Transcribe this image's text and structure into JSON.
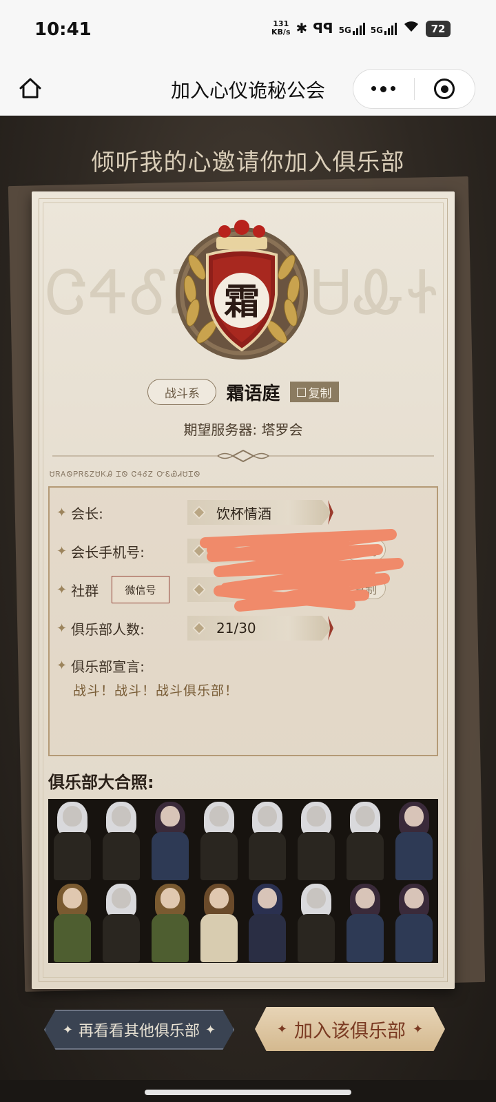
{
  "status_bar": {
    "time": "10:41",
    "speed_value": "131",
    "speed_unit": "KB/s",
    "network_1": "5G",
    "network_2": "5G",
    "battery": "72"
  },
  "nav": {
    "title": "加入心仪诡秘公会"
  },
  "page": {
    "headline": "倾听我的心邀请你加入俱乐部",
    "watermark_left": "ᏣᏎᎴᏃ",
    "watermark_right": "ᎴᏌᎲᏐ",
    "rune_line": "ᏌᏒᎪᏫᏢᏒᏋᏃᏌᏦᎯ ᏆᏫ ᏣᏎᎴᏃ ᏅᏋᏯᏗᏌᏆᏫ"
  },
  "club": {
    "emblem_char": "霜",
    "type_tag": "战斗系",
    "name": "霜语庭",
    "copy_label": "复制",
    "server_label": "期望服务器:",
    "server_value": "塔罗会"
  },
  "info": {
    "leader_label": "会长:",
    "leader_value": "饮杯情酒",
    "phone_label": "会长手机号:",
    "phone_copy": "复制",
    "community_label": "社群",
    "community_tag": "微信号",
    "community_copy": "复制",
    "members_label": "俱乐部人数:",
    "members_value": "21/30",
    "manifesto_label": "俱乐部宣言:",
    "manifesto_value": "战斗！战斗！战斗俱乐部！"
  },
  "photo": {
    "title": "俱乐部大合照:"
  },
  "buttons": {
    "browse_label": "再看看其他俱乐部",
    "join_label": "加入该俱乐部",
    "spark": "✦"
  },
  "colors": {
    "accent_red": "#9b3b2d",
    "gold": "#b49a76",
    "scribble": "#f08a6a"
  }
}
